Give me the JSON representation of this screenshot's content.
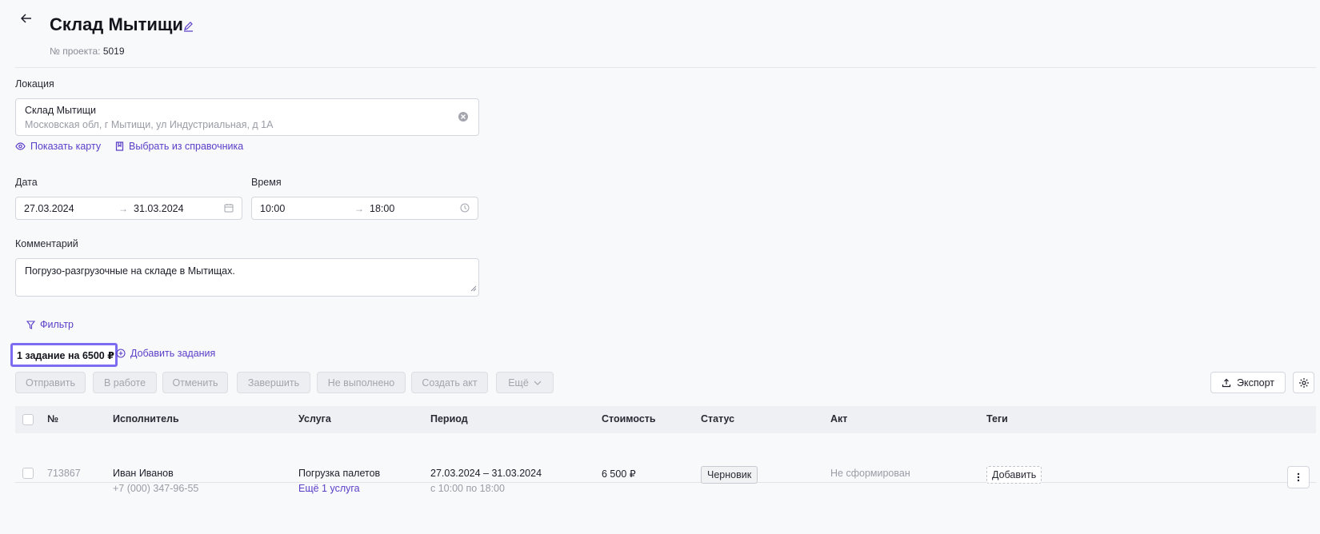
{
  "header": {
    "title": "Склад Мытищи",
    "project_label": "№ проекта:",
    "project_number": "5019"
  },
  "location": {
    "label": "Локация",
    "name": "Склад Мытищи",
    "address": "Московская обл, г Мытищи, ул Индустриальная, д 1А",
    "show_map": "Показать карту",
    "choose_directory": "Выбрать из справочника"
  },
  "date": {
    "label": "Дата",
    "start": "27.03.2024",
    "end": "31.03.2024"
  },
  "time": {
    "label": "Время",
    "start": "10:00",
    "end": "18:00"
  },
  "comment": {
    "label": "Комментарий",
    "value": "Погрузо-разгрузочные на складе в Мытищах."
  },
  "filter_label": "Фильтр",
  "tasks_summary": "1 задание на 6500 ₽",
  "add_tasks": "Добавить задания",
  "toolbar": {
    "send": "Отправить",
    "in_work": "В работе",
    "cancel": "Отменить",
    "finish": "Завершить",
    "not_done": "Не выполнено",
    "create_act": "Создать акт",
    "more": "Ещё",
    "export": "Экспорт"
  },
  "table": {
    "columns": [
      "№",
      "Исполнитель",
      "Услуга",
      "Период",
      "Стоимость",
      "Статус",
      "Акт",
      "Теги"
    ],
    "rows": [
      {
        "id": "713867",
        "executor_name": "Иван Иванов",
        "executor_phone": "+7 (000) 347-96-55",
        "service": "Погрузка палетов",
        "more_services": "Ещё 1 услуга",
        "period": "27.03.2024 – 31.03.2024",
        "period_time": "с 10:00 по 18:00",
        "cost": "6 500 ₽",
        "status": "Черновик",
        "act": "Не сформирован",
        "tag_add": "Добавить"
      }
    ]
  },
  "colors": {
    "accent": "#5b3ec8",
    "highlight": "#7b6cf0"
  }
}
